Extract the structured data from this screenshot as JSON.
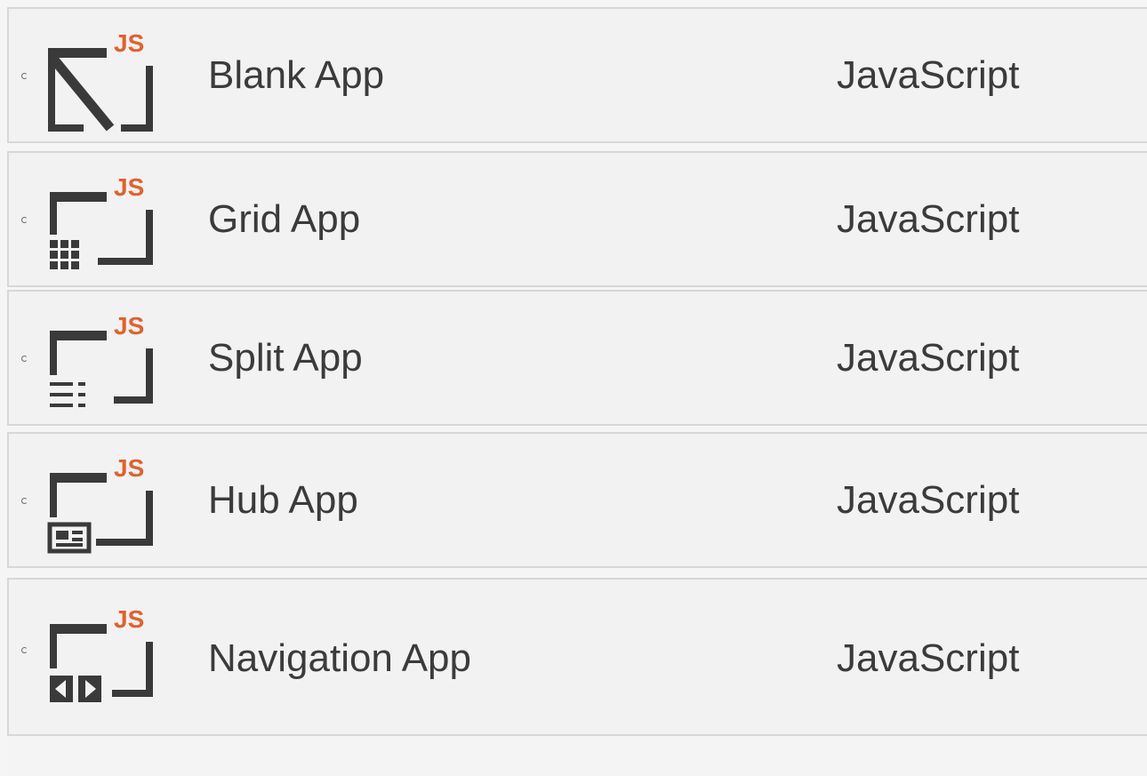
{
  "templates": [
    {
      "name": "Blank App",
      "language": "JavaScript",
      "badge": "JS",
      "icon": "blank-app-icon"
    },
    {
      "name": "Grid App",
      "language": "JavaScript",
      "badge": "JS",
      "icon": "grid-app-icon"
    },
    {
      "name": "Split App",
      "language": "JavaScript",
      "badge": "JS",
      "icon": "split-app-icon"
    },
    {
      "name": "Hub App",
      "language": "JavaScript",
      "badge": "JS",
      "icon": "hub-app-icon"
    },
    {
      "name": "Navigation App",
      "language": "JavaScript",
      "badge": "JS",
      "icon": "navigation-app-icon"
    }
  ],
  "colors": {
    "badge": "#e2612a",
    "icon_dark": "#3a3a3a",
    "text": "#3b3b3b",
    "row_bg": "#f2f2f2",
    "row_border": "#d7d7d7"
  }
}
